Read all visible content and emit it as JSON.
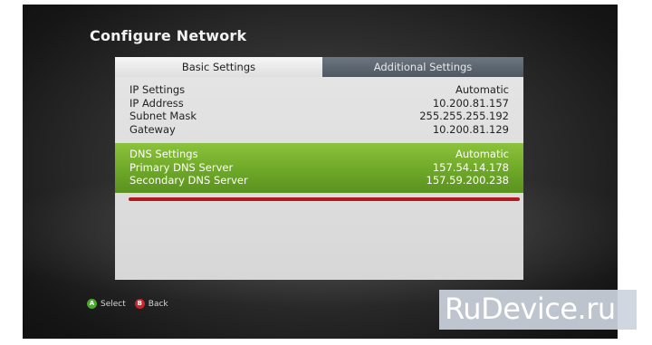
{
  "title": "Configure Network",
  "tabs": [
    {
      "label": "Basic Settings",
      "active": true
    },
    {
      "label": "Additional Settings",
      "active": false
    }
  ],
  "settings": [
    {
      "label": "IP Settings",
      "value": "Automatic"
    },
    {
      "label": "IP Address",
      "value": "10.200.81.157"
    },
    {
      "label": "Subnet Mask",
      "value": "255.255.255.192"
    },
    {
      "label": "Gateway",
      "value": "10.200.81.129"
    }
  ],
  "dns": [
    {
      "label": "DNS Settings",
      "value": "Automatic"
    },
    {
      "label": "Primary DNS Server",
      "value": "157.54.14.178"
    },
    {
      "label": "Secondary DNS Server",
      "value": "157.59.200.238"
    }
  ],
  "footer": {
    "a_glyph": "A",
    "select_label": "Select",
    "b_glyph": "B",
    "back_label": "Back"
  },
  "watermark": "RuDevice.ru",
  "colors": {
    "highlight": "#6ea828",
    "underline": "#b2191d",
    "button_a": "#4aa82b",
    "button_b": "#c9262b"
  }
}
